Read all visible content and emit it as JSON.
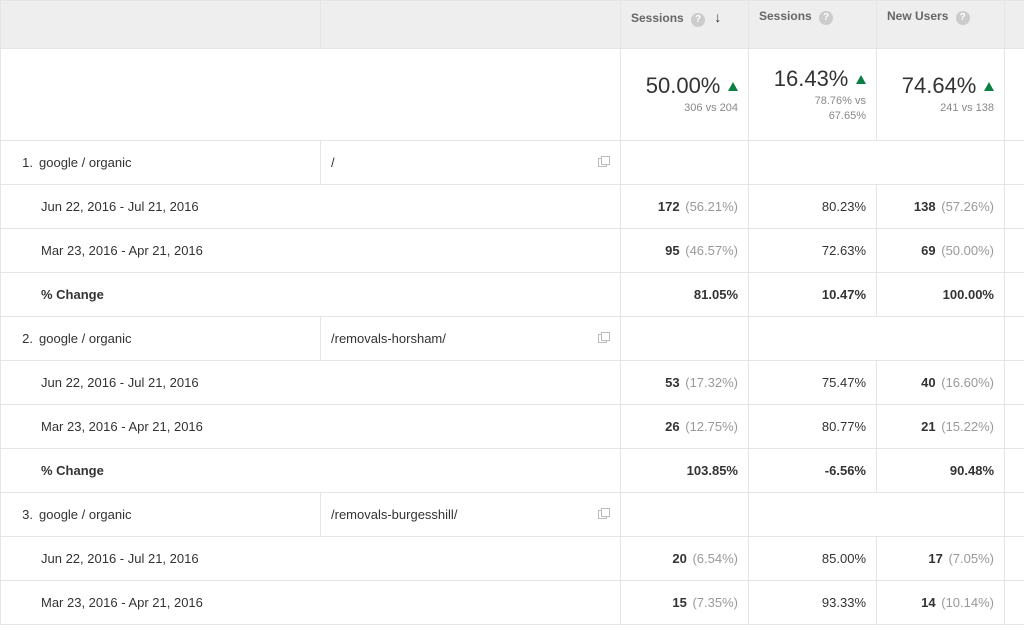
{
  "header": {
    "sessions": "Sessions",
    "pct_new_sessions": "Sessions",
    "new_users": "New Users"
  },
  "summary": {
    "sessions": {
      "pct": "50.00%",
      "sub": "306 vs 204"
    },
    "pctnew": {
      "pct": "16.43%",
      "sub1": "78.76% vs",
      "sub2": "67.65%"
    },
    "newusers": {
      "pct": "74.64%",
      "sub": "241 vs 138"
    }
  },
  "rows": [
    {
      "n": "1.",
      "source": "google / organic",
      "page": "/",
      "periods": [
        {
          "label": "Jun 22, 2016 - Jul 21, 2016",
          "sessions": "172",
          "sessions_pct": "(56.21%)",
          "pctnew": "80.23%",
          "newusers": "138",
          "newusers_pct": "(57.26%)"
        },
        {
          "label": "Mar 23, 2016 - Apr 21, 2016",
          "sessions": "95",
          "sessions_pct": "(46.57%)",
          "pctnew": "72.63%",
          "newusers": "69",
          "newusers_pct": "(50.00%)"
        }
      ],
      "change": {
        "label": "% Change",
        "sessions": "81.05%",
        "pctnew": "10.47%",
        "newusers": "100.00%"
      }
    },
    {
      "n": "2.",
      "source": "google / organic",
      "page": "/removals-horsham/",
      "periods": [
        {
          "label": "Jun 22, 2016 - Jul 21, 2016",
          "sessions": "53",
          "sessions_pct": "(17.32%)",
          "pctnew": "75.47%",
          "newusers": "40",
          "newusers_pct": "(16.60%)"
        },
        {
          "label": "Mar 23, 2016 - Apr 21, 2016",
          "sessions": "26",
          "sessions_pct": "(12.75%)",
          "pctnew": "80.77%",
          "newusers": "21",
          "newusers_pct": "(15.22%)"
        }
      ],
      "change": {
        "label": "% Change",
        "sessions": "103.85%",
        "pctnew": "-6.56%",
        "newusers": "90.48%"
      }
    },
    {
      "n": "3.",
      "source": "google / organic",
      "page": "/removals-burgesshill/",
      "periods": [
        {
          "label": "Jun 22, 2016 - Jul 21, 2016",
          "sessions": "20",
          "sessions_pct": "(6.54%)",
          "pctnew": "85.00%",
          "newusers": "17",
          "newusers_pct": "(7.05%)"
        },
        {
          "label": "Mar 23, 2016 - Apr 21, 2016",
          "sessions": "15",
          "sessions_pct": "(7.35%)",
          "pctnew": "93.33%",
          "newusers": "14",
          "newusers_pct": "(10.14%)"
        }
      ],
      "change": null
    }
  ]
}
